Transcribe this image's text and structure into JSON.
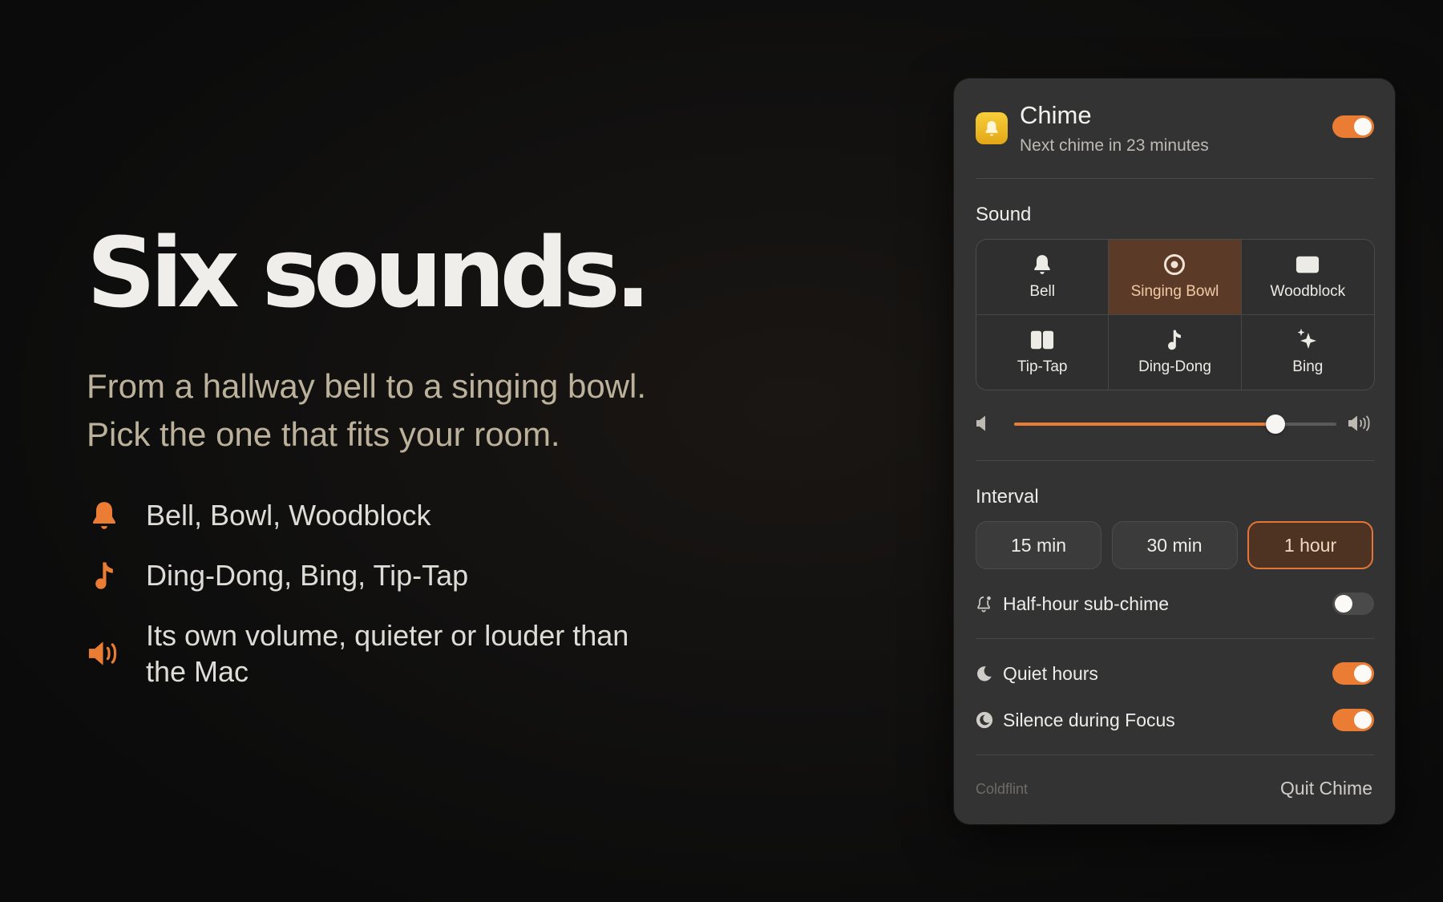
{
  "hero": {
    "title": "Six sounds.",
    "subtitle_line1": "From a hallway bell to a singing bowl.",
    "subtitle_line2": "Pick the one that fits your room.",
    "features": [
      {
        "icon": "bell-icon",
        "text": "Bell, Bowl, Woodblock"
      },
      {
        "icon": "music-note-icon",
        "text": "Ding-Dong, Bing, Tip-Tap"
      },
      {
        "icon": "speaker-icon",
        "text": "Its own volume, quieter or louder than the Mac"
      }
    ],
    "accent_color": "#EA7C33"
  },
  "panel": {
    "app_name": "Chime",
    "status": "Next chime in 23 minutes",
    "enabled": true,
    "sound_section": "Sound",
    "sounds": [
      {
        "label": "Bell",
        "icon": "bell-icon",
        "selected": false
      },
      {
        "label": "Singing Bowl",
        "icon": "singing-bowl-icon",
        "selected": true
      },
      {
        "label": "Woodblock",
        "icon": "woodblock-icon",
        "selected": false
      },
      {
        "label": "Tip-Tap",
        "icon": "tip-tap-icon",
        "selected": false
      },
      {
        "label": "Ding-Dong",
        "icon": "music-note-icon",
        "selected": false
      },
      {
        "label": "Bing",
        "icon": "sparkle-icon",
        "selected": false
      }
    ],
    "volume_level": 0.81,
    "interval_section": "Interval",
    "intervals": [
      {
        "label": "15 min",
        "selected": false
      },
      {
        "label": "30 min",
        "selected": false
      },
      {
        "label": "1 hour",
        "selected": true
      }
    ],
    "half_hour": {
      "label": "Half-hour sub-chime",
      "on": false
    },
    "quiet_hours": {
      "label": "Quiet hours",
      "on": true
    },
    "silence_focus": {
      "label": "Silence during Focus",
      "on": true
    },
    "footer_brand": "Coldflint",
    "quit_label": "Quit Chime"
  }
}
